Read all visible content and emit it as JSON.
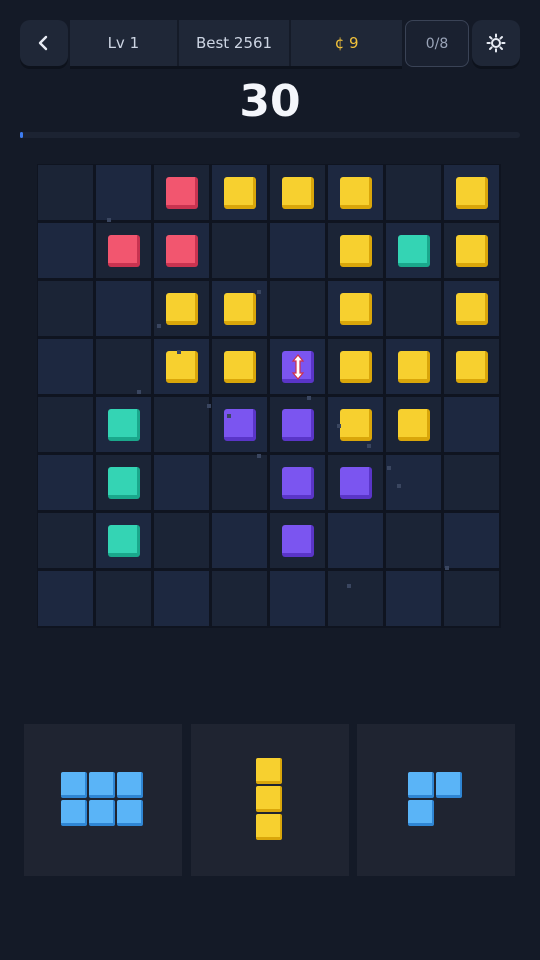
{
  "header": {
    "back_icon": "chevron-left-icon",
    "level": "Lv 1",
    "best": "Best 2561",
    "coins": "¢ 9",
    "goal": "0/8",
    "settings_icon": "gear-icon"
  },
  "score": "30",
  "progress": 0.006,
  "colors": {
    "red": {
      "face": "#f2566f",
      "edge": "#c93350"
    },
    "yellow": {
      "face": "#f7d02f",
      "edge": "#d9a60a"
    },
    "teal": {
      "face": "#34d4b4",
      "edge": "#1aa88c"
    },
    "purple": {
      "face": "#7b55f0",
      "edge": "#5a35c8"
    },
    "blue": {
      "face": "#5ab4f7",
      "edge": "#2f86d4"
    }
  },
  "board": {
    "size": 8,
    "rows": [
      [
        ".",
        ".",
        "R",
        "Y",
        "Y",
        "Y",
        ".",
        "Y"
      ],
      [
        ".",
        "R",
        "R",
        ".",
        ".",
        "Y",
        "T",
        "Y"
      ],
      [
        ".",
        ".",
        "Y",
        "Y",
        ".",
        "Y",
        ".",
        "Y"
      ],
      [
        ".",
        ".",
        "Y",
        "Y",
        "P",
        "Y",
        "Y",
        "Y"
      ],
      [
        ".",
        "T",
        ".",
        "P",
        "P",
        "Y",
        "Y",
        "."
      ],
      [
        ".",
        "T",
        ".",
        ".",
        "P",
        "P",
        ".",
        "."
      ],
      [
        ".",
        "T",
        ".",
        ".",
        "P",
        ".",
        ".",
        "."
      ],
      [
        ".",
        ".",
        ".",
        ".",
        ".",
        ".",
        ".",
        "."
      ]
    ],
    "cursor": {
      "row": 3,
      "col": 4,
      "icon": "resize-vertical-cursor-icon"
    }
  },
  "tray": [
    {
      "name": "tray-piece-blue-2x3",
      "color": "blue",
      "cells": [
        [
          0,
          0
        ],
        [
          0,
          1
        ],
        [
          0,
          2
        ],
        [
          1,
          0
        ],
        [
          1,
          1
        ],
        [
          1,
          2
        ]
      ]
    },
    {
      "name": "tray-piece-yellow-vertical-3",
      "color": "yellow",
      "cells": [
        [
          0,
          0
        ],
        [
          1,
          0
        ],
        [
          2,
          0
        ]
      ]
    },
    {
      "name": "tray-piece-blue-l-corner",
      "color": "blue",
      "cells": [
        [
          0,
          0
        ],
        [
          0,
          1
        ],
        [
          1,
          0
        ]
      ]
    }
  ]
}
